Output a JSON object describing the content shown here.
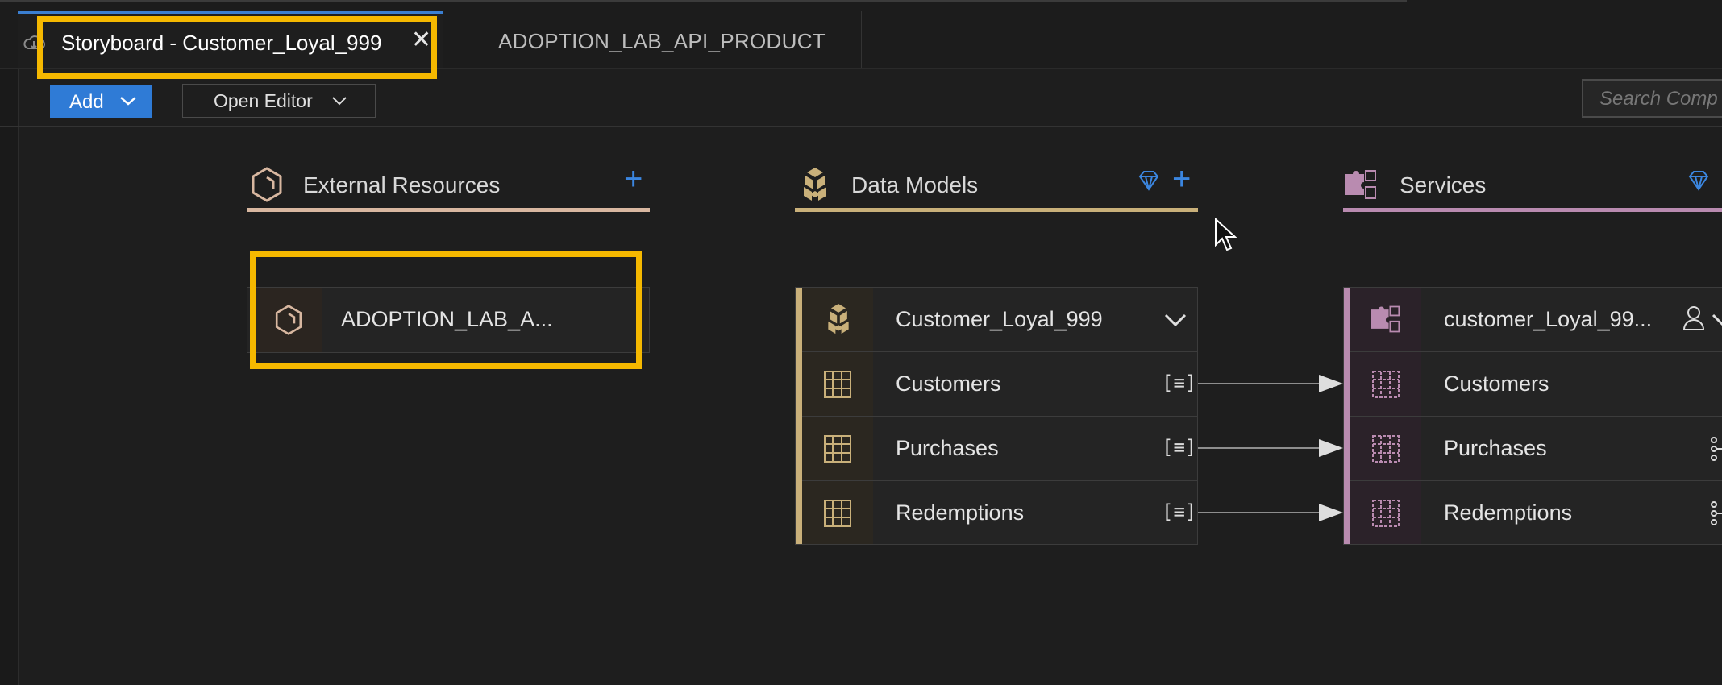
{
  "tabs": [
    {
      "label": "Storyboard - Customer_Loyal_999",
      "active": true,
      "close_glyph": "✕"
    },
    {
      "label": "ADOPTION_LAB_API_PRODUCT",
      "active": false
    }
  ],
  "toolbar": {
    "add_label": "Add",
    "open_editor_label": "Open Editor",
    "search_placeholder": "Search Comp"
  },
  "columns": {
    "external": {
      "title": "External Resources",
      "add_glyph": "+",
      "accent": "#d8b7a0"
    },
    "models": {
      "title": "Data Models",
      "add_glyph": "+",
      "accent": "#c9b07a"
    },
    "services": {
      "title": "Services",
      "accent": "#b98bb0"
    }
  },
  "external_node": {
    "label": "ADOPTION_LAB_A..."
  },
  "model_node": {
    "label": "Customer_Loyal_999",
    "rows": [
      "Customers",
      "Purchases",
      "Redemptions"
    ],
    "row_glyph": "[≡]"
  },
  "service_node": {
    "label": "customer_Loyal_99...",
    "rows": [
      "Customers",
      "Purchases",
      "Redemptions"
    ]
  },
  "colors": {
    "highlight": "#f5b800",
    "accent_blue": "#2f7bd6"
  }
}
